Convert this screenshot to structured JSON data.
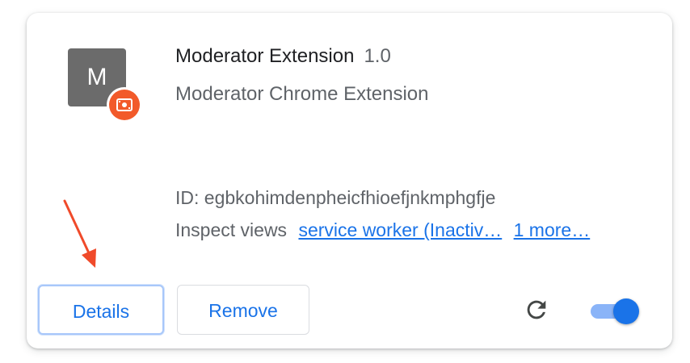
{
  "extension": {
    "icon_letter": "M",
    "name": "Moderator Extension",
    "version": "1.0",
    "description": "Moderator Chrome Extension",
    "id_text": "ID: egbkohimdenpheicfhioefjnkmphgfje",
    "inspect_label": "Inspect views",
    "inspect_links": [
      "service worker (Inactiv…",
      "1 more…"
    ]
  },
  "actions": {
    "details_label": "Details",
    "remove_label": "Remove",
    "enabled": true
  },
  "icons": {
    "badge": "tape-icon",
    "reload": "reload-icon",
    "annotation_arrow": "red-arrow"
  },
  "colors": {
    "accent": "#1a73e8",
    "badge": "#f25a2a",
    "annotation_arrow": "#f04a2a",
    "icon_bg": "#6b6b6b"
  }
}
